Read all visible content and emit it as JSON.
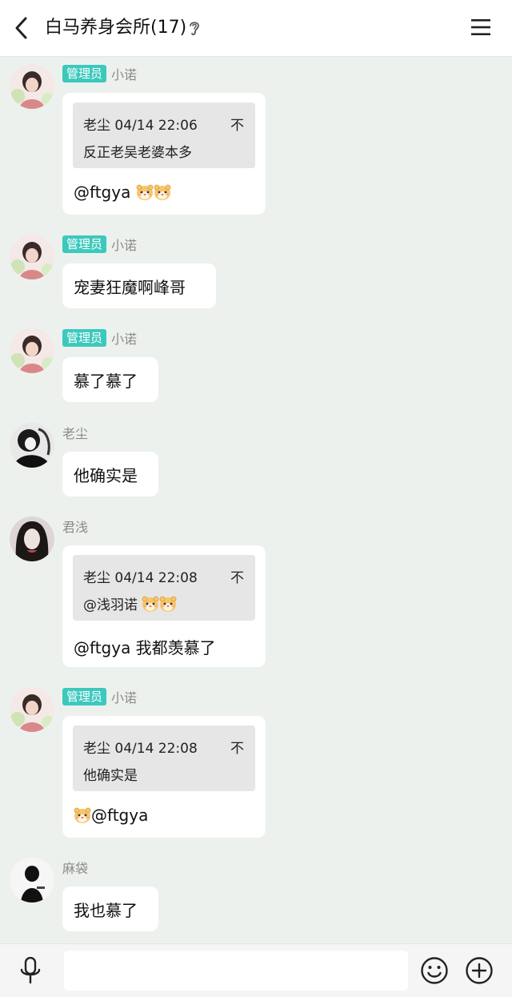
{
  "header": {
    "title": "白马养身会所(17)"
  },
  "messages": [
    {
      "badge": "管理员",
      "sender": "小诺",
      "quote": {
        "head": "老尘 04/14 22:06",
        "body": "反正老吴老婆本多",
        "pin": "不"
      },
      "text": "@ftgya"
    },
    {
      "badge": "管理员",
      "sender": "小诺",
      "text": "宠妻狂魔啊峰哥"
    },
    {
      "badge": "管理员",
      "sender": "小诺",
      "text": "慕了慕了"
    },
    {
      "sender": "老尘",
      "text": "他确实是"
    },
    {
      "sender": "君浅",
      "quote": {
        "head": "老尘 04/14 22:08",
        "body": "@浅羽诺",
        "pin": "不"
      },
      "text": "@ftgya 我都羡慕了"
    },
    {
      "badge": "管理员",
      "sender": "小诺",
      "quote": {
        "head": "老尘 04/14 22:08",
        "body": "他确实是",
        "pin": "不"
      },
      "text": "@ftgya"
    },
    {
      "sender": "麻袋",
      "text": "我也慕了"
    }
  ],
  "bottom_bar": {
    "input_placeholder": ""
  },
  "icons": {
    "back": "chevron-left-icon",
    "ear": "ear-icon",
    "menu": "hamburger-menu-icon",
    "mic": "microphone-icon",
    "emoji": "smile-icon",
    "more": "plus-circle-icon",
    "sticker": "hamster-emoji-icon"
  },
  "colors": {
    "badge": "#3cc9bd",
    "background": "#edf1ed",
    "bubble": "#ffffff",
    "quote": "#e6e6e6"
  }
}
